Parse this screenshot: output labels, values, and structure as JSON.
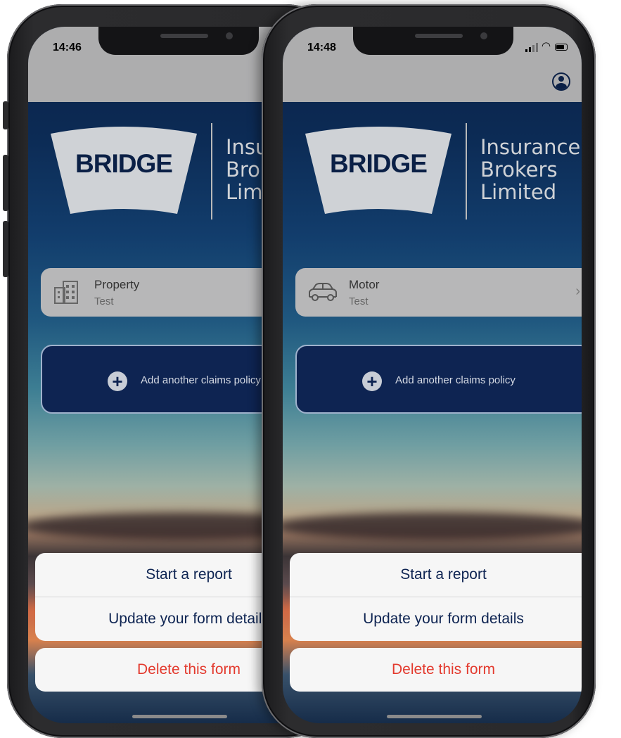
{
  "brand": {
    "logo_word": "BRIDGE",
    "tagline": "Insurance\nBrokers\nLimited",
    "navy": "#0b2046",
    "logo_plate": "#cfd2d6"
  },
  "phones": [
    {
      "time": "14:46",
      "policy": {
        "name": "Property",
        "subtitle": "Test",
        "icon": "building-icon"
      },
      "add_label": "Add another claims policy",
      "actions": {
        "start": "Start a report",
        "update": "Update your form details",
        "delete": "Delete this form"
      }
    },
    {
      "time": "14:48",
      "policy": {
        "name": "Motor",
        "subtitle": "Test",
        "icon": "car-icon"
      },
      "add_label": "Add another claims policy",
      "actions": {
        "start": "Start a report",
        "update": "Update your form details",
        "delete": "Delete this form"
      }
    }
  ],
  "colors": {
    "destructive": "#e33a2e",
    "sheet_bg": "#f6f6f6",
    "status_bar": "#adadae"
  }
}
